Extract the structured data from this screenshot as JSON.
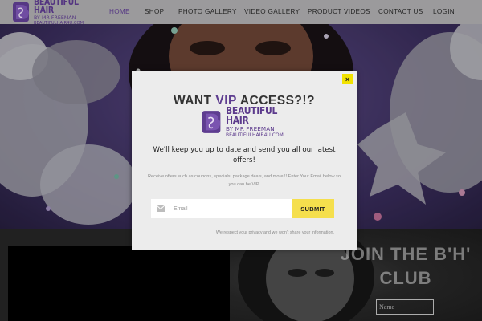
{
  "header": {
    "logo": {
      "line1": "BEAUTIFUL HAIR",
      "line2": "BY MR FREEMAN",
      "line3": "BEAUTIFULHAIR4U.COM"
    },
    "nav": [
      {
        "label": "HOME",
        "active": true
      },
      {
        "label": "SHOP",
        "active": false
      },
      {
        "label": "PHOTO GALLERY",
        "active": false
      },
      {
        "label": "VIDEO GALLERY",
        "active": false
      },
      {
        "label": "PRODUCT VIDEOS",
        "active": false
      },
      {
        "label": "CONTACT US",
        "active": false
      },
      {
        "label": "LOGIN",
        "active": false
      }
    ]
  },
  "modal": {
    "close_label": "×",
    "title_prefix": "WANT ",
    "title_vip": "VIP",
    "title_suffix": " ACCESS?!?",
    "logo": {
      "line1": "BEAUTIFUL HAIR",
      "line2": "BY MR FREEMAN",
      "line3": "BEAUTIFULHAIR4U.COM"
    },
    "lead": "We'll keep you up to date and send you all our latest offers!",
    "sub": "Receive offers such as coupons, specials, package deals, and more!!! Enter Your Email below so you can be VIP.",
    "email_placeholder": "Email",
    "submit_label": "SUBMIT",
    "privacy": "We respect your privacy and we won't share your information."
  },
  "club": {
    "title_line1": "JOIN THE B'H'",
    "title_line2": "CLUB",
    "name_placeholder": "Name"
  },
  "colors": {
    "brand_purple": "#5e3d90",
    "submit_yellow": "#f5df4d",
    "close_yellow": "#f2e200",
    "header_gray": "#a9a8aa"
  },
  "icons": {
    "close": "close-icon",
    "mail": "mail-icon",
    "logo": "hair-logo-icon"
  }
}
